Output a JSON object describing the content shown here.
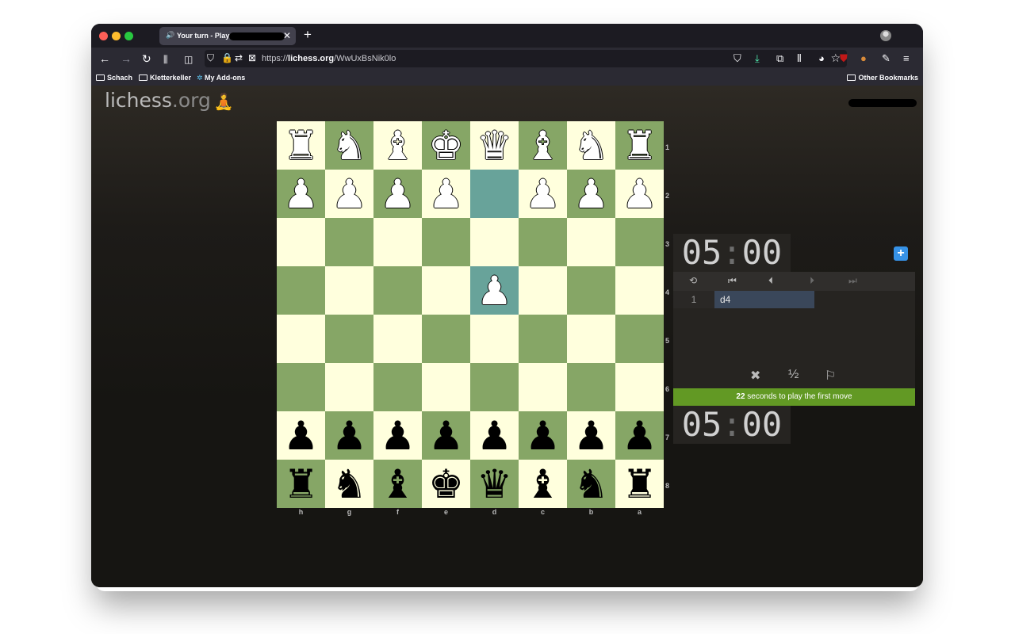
{
  "browser": {
    "tab_audio": "🔊",
    "tab_title": "Your turn - Play",
    "tab_close": "✕",
    "new_tab": "+",
    "url_prefix": "https://",
    "url_host": "lichess.org",
    "url_path": "/WwUxBsNik0lo",
    "bookmarks": [
      "Schach",
      "Kletterkeller",
      "My Add-ons"
    ],
    "other_bookmarks": "Other Bookmarks"
  },
  "site": {
    "logo_main": "lichess",
    "logo_tld": ".org",
    "logo_icon": "🧘"
  },
  "board": {
    "orientation": "black",
    "ranks": [
      "1",
      "2",
      "3",
      "4",
      "5",
      "6",
      "7",
      "8"
    ],
    "files": [
      "h",
      "g",
      "f",
      "e",
      "d",
      "c",
      "b",
      "a"
    ],
    "rows": [
      [
        "wR",
        "wN",
        "wB",
        "wK",
        "wQ",
        "wB",
        "wN",
        "wR"
      ],
      [
        "wP",
        "wP",
        "wP",
        "wP",
        "",
        "wP",
        "wP",
        "wP"
      ],
      [
        "",
        "",
        "",
        "",
        "",
        "",
        "",
        ""
      ],
      [
        "",
        "",
        "",
        "",
        "wP",
        "",
        "",
        ""
      ],
      [
        "",
        "",
        "",
        "",
        "",
        "",
        "",
        ""
      ],
      [
        "",
        "",
        "",
        "",
        "",
        "",
        "",
        ""
      ],
      [
        "bP",
        "bP",
        "bP",
        "bP",
        "bP",
        "bP",
        "bP",
        "bP"
      ],
      [
        "bR",
        "bN",
        "bB",
        "bK",
        "bQ",
        "bB",
        "bN",
        "bR"
      ]
    ],
    "highlights": [
      "d2",
      "d4"
    ],
    "colors": {
      "light": "#ffffdd",
      "dark": "#86a666",
      "highlight": "#68a39a"
    }
  },
  "clocks": {
    "top": {
      "min": "05",
      "sec": "00"
    },
    "bottom": {
      "min": "05",
      "sec": "00"
    }
  },
  "moves": {
    "number": "1",
    "white": "d4"
  },
  "controls": {
    "flip": "⟲",
    "first": "⏮",
    "prev": "⏴",
    "next": "⏵",
    "last": "⏭"
  },
  "actions": {
    "abort": "✖",
    "draw": "½",
    "resign": "⚐"
  },
  "banner": {
    "seconds": "22",
    "text": " seconds to play the first move"
  },
  "plus_button": "+"
}
